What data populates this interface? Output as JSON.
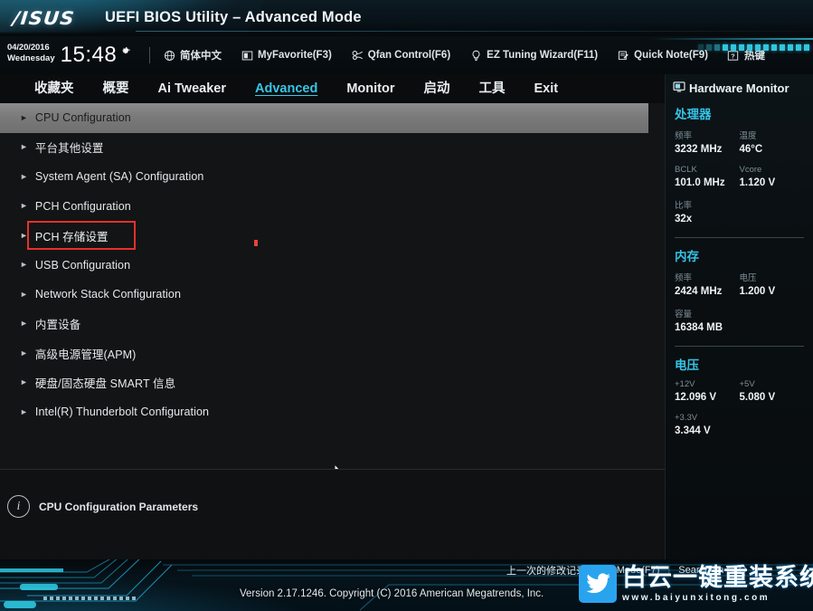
{
  "header": {
    "logo": "/ISUS",
    "title": "UEFI BIOS Utility – Advanced Mode"
  },
  "toolbar": {
    "date": "04/20/2016",
    "weekday": "Wednesday",
    "time": "15:48",
    "gear_icon": "gear-icon",
    "items": [
      {
        "label": "简体中文",
        "icon": "globe-icon"
      },
      {
        "label": "MyFavorite(F3)",
        "icon": "favorite-icon"
      },
      {
        "label": "Qfan Control(F6)",
        "icon": "fan-icon"
      },
      {
        "label": "EZ Tuning Wizard(F11)",
        "icon": "lightbulb-icon"
      },
      {
        "label": "Quick Note(F9)",
        "icon": "note-icon"
      },
      {
        "label": "热键",
        "icon": "question-icon"
      }
    ]
  },
  "tabs": [
    {
      "label": "收藏夹",
      "active": false
    },
    {
      "label": "概要",
      "active": false
    },
    {
      "label": "Ai Tweaker",
      "active": false
    },
    {
      "label": "Advanced",
      "active": true
    },
    {
      "label": "Monitor",
      "active": false
    },
    {
      "label": "启动",
      "active": false
    },
    {
      "label": "工具",
      "active": false
    },
    {
      "label": "Exit",
      "active": false
    }
  ],
  "menu": {
    "items": [
      {
        "label": "CPU Configuration",
        "selected": true,
        "boxed": false
      },
      {
        "label": "平台其他设置",
        "selected": false,
        "boxed": false
      },
      {
        "label": "System Agent (SA) Configuration",
        "selected": false,
        "boxed": false
      },
      {
        "label": "PCH Configuration",
        "selected": false,
        "boxed": false
      },
      {
        "label": "PCH 存储设置",
        "selected": false,
        "boxed": true
      },
      {
        "label": "USB Configuration",
        "selected": false,
        "boxed": false
      },
      {
        "label": "Network Stack Configuration",
        "selected": false,
        "boxed": false
      },
      {
        "label": "内置设备",
        "selected": false,
        "boxed": false
      },
      {
        "label": "高级电源管理(APM)",
        "selected": false,
        "boxed": false
      },
      {
        "label": "硬盘/固态硬盘 SMART 信息",
        "selected": false,
        "boxed": false
      },
      {
        "label": "Intel(R) Thunderbolt Configuration",
        "selected": false,
        "boxed": false
      }
    ],
    "arrow_glyph": "►",
    "highlight_color": "#e8302c"
  },
  "help": {
    "icon": "info-icon",
    "text": "CPU Configuration Parameters"
  },
  "hardware_monitor": {
    "title": "Hardware Monitor",
    "title_icon": "monitor-icon",
    "sections": [
      {
        "name": "处理器",
        "cells": [
          {
            "key": "频率",
            "value": "3232 MHz",
            "full": false
          },
          {
            "key": "温度",
            "value": "46°C",
            "full": false
          },
          {
            "key": "BCLK",
            "value": "101.0 MHz",
            "full": false
          },
          {
            "key": "Vcore",
            "value": "1.120 V",
            "full": false
          },
          {
            "key": "比率",
            "value": "32x",
            "full": true
          }
        ]
      },
      {
        "name": "内存",
        "cells": [
          {
            "key": "频率",
            "value": "2424 MHz",
            "full": false
          },
          {
            "key": "电压",
            "value": "1.200 V",
            "full": false
          },
          {
            "key": "容量",
            "value": "16384 MB",
            "full": true
          }
        ]
      },
      {
        "name": "电压",
        "cells": [
          {
            "key": "+12V",
            "value": "12.096 V",
            "full": false
          },
          {
            "key": "+5V",
            "value": "5.080 V",
            "full": false
          },
          {
            "key": "+3.3V",
            "value": "3.344 V",
            "full": true
          }
        ]
      }
    ]
  },
  "footer": {
    "version": "Version 2.17.1246. Copyright (C) 2016 American Megatrends, Inc.",
    "links": [
      {
        "label": "上一次的修改记录"
      },
      {
        "label": "EzMode(F7)"
      },
      {
        "label": "Search on FAQ"
      }
    ],
    "separator": "|"
  },
  "watermark": {
    "icon": "twitter-bird-icon",
    "title": "白云一键重装系统",
    "url": "www.baiyunxitong.com"
  },
  "colors": {
    "accent_cyan": "#35c3e6",
    "red_box": "#e8302c",
    "panel_bg": "#0a0f12",
    "content_bg": "#131415"
  }
}
